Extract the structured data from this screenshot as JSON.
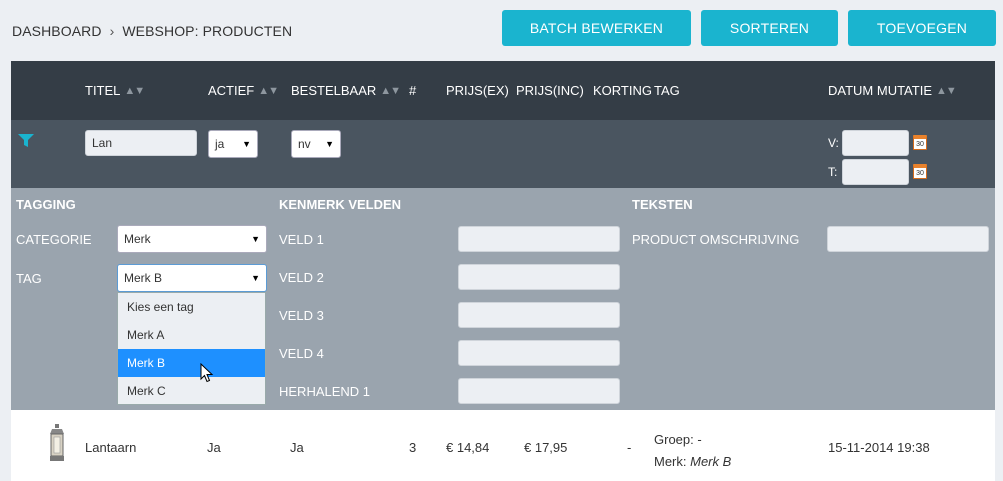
{
  "breadcrumb": {
    "item1": "DASHBOARD",
    "sep": "›",
    "item2": "WEBSHOP: PRODUCTEN"
  },
  "toolbar": {
    "batch": "BATCH BEWERKEN",
    "sort": "SORTEREN",
    "add": "TOEVOEGEN"
  },
  "columns": {
    "titel": "TITEL",
    "actief": "ACTIEF",
    "bestelbaar": "BESTELBAAR",
    "hash": "#",
    "prijs_ex": "PRIJS(EX)",
    "prijs_inc": "PRIJS(INC)",
    "korting": "KORTING",
    "tag": "TAG",
    "datum": "DATUM MUTATIE",
    "sort_arrows": "▲▼"
  },
  "filters": {
    "titel_value": "Lan",
    "actief_value": "ja",
    "bestelbaar_value": "nv",
    "v_label": "V:",
    "t_label": "T:",
    "v_value": "",
    "t_value": "",
    "cal_day": "30"
  },
  "panel": {
    "tagging_title": "TAGGING",
    "categorie_label": "CATEGORIE",
    "categorie_value": "Merk",
    "tag_label": "TAG",
    "tag_value": "Merk B",
    "dropdown_options": [
      "Kies een tag",
      "Merk A",
      "Merk B",
      "Merk C"
    ],
    "kenmerk_title": "KENMERK VELDEN",
    "fields": [
      "VELD 1",
      "VELD 2",
      "VELD 3",
      "VELD 4",
      "HERHALEND 1"
    ],
    "teksten_title": "TEKSTEN",
    "omschrijving_label": "PRODUCT OMSCHRIJVING"
  },
  "row": {
    "title": "Lantaarn",
    "actief": "Ja",
    "bestelbaar": "Ja",
    "count": "3",
    "prijs_ex": "€ 14,84",
    "prijs_inc": "€ 17,95",
    "korting": "-",
    "groep_label": "Groep:",
    "groep_value": "-",
    "merk_label": "Merk:",
    "merk_value": "Merk B",
    "datum": "15-11-2014 19:38"
  },
  "colors": {
    "accent": "#1ab4cf",
    "header": "#343d46",
    "filter": "#4a5560",
    "panel": "#9aa4ae",
    "select": "#1e90ff"
  }
}
